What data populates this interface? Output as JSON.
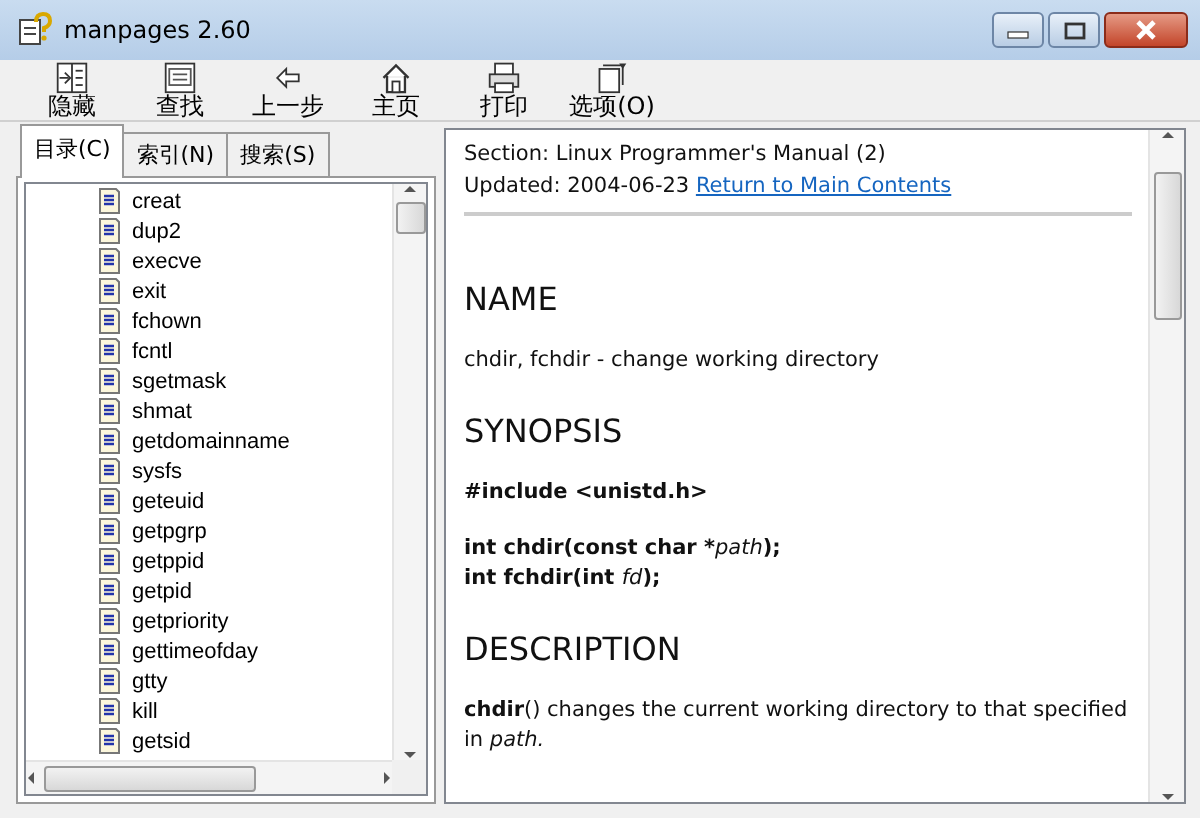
{
  "window": {
    "title": "manpages 2.60"
  },
  "toolbar": [
    {
      "label": "隐藏",
      "kind": "hide"
    },
    {
      "label": "查找",
      "kind": "find"
    },
    {
      "label": "上一步",
      "kind": "back"
    },
    {
      "label": "主页",
      "kind": "home"
    },
    {
      "label": "打印",
      "kind": "print"
    },
    {
      "label": "选项(O)",
      "kind": "options"
    }
  ],
  "tabs": [
    {
      "label": "目录(C)",
      "selected": true
    },
    {
      "label": "索引(N)",
      "selected": false
    },
    {
      "label": "搜索(S)",
      "selected": false
    }
  ],
  "toc": {
    "items": [
      "creat",
      "dup2",
      "execve",
      "exit",
      "fchown",
      "fcntl",
      "sgetmask",
      "shmat",
      "getdomainname",
      "sysfs",
      "geteuid",
      "getpgrp",
      "getppid",
      "getpid",
      "getpriority",
      "gettimeofday",
      "gtty",
      "kill",
      "getsid"
    ]
  },
  "document": {
    "section": "Section: Linux Programmer's Manual (2)",
    "updated": "Updated: 2004-06-23",
    "link": "Return to Main Contents",
    "blocks": [
      {
        "kind": "heading",
        "parts": [
          {
            "kind": "plain",
            "text": "NAME"
          }
        ]
      },
      {
        "kind": "para",
        "parts": [
          {
            "kind": "plain",
            "text": "chdir, fchdir - change working directory"
          }
        ]
      },
      {
        "kind": "heading",
        "parts": [
          {
            "kind": "plain",
            "text": "SYNOPSIS"
          }
        ]
      },
      {
        "kind": "para",
        "parts": [
          {
            "kind": "bold",
            "text": "#include <unistd.h>"
          }
        ]
      },
      {
        "kind": "line",
        "parts": [
          {
            "kind": "bold",
            "text": "int chdir(const char *"
          },
          {
            "kind": "italic",
            "text": "path"
          },
          {
            "kind": "bold",
            "text": ");"
          }
        ]
      },
      {
        "kind": "para",
        "parts": [
          {
            "kind": "bold",
            "text": "int fchdir(int "
          },
          {
            "kind": "italic",
            "text": "fd"
          },
          {
            "kind": "bold",
            "text": ");"
          }
        ]
      },
      {
        "kind": "heading",
        "parts": [
          {
            "kind": "plain",
            "text": "DESCRIPTION"
          }
        ]
      },
      {
        "kind": "para",
        "parts": [
          {
            "kind": "bold",
            "text": "chdir"
          },
          {
            "kind": "plain",
            "text": "() changes the current working directory to that specified in "
          },
          {
            "kind": "italic",
            "text": "path."
          }
        ]
      }
    ]
  }
}
